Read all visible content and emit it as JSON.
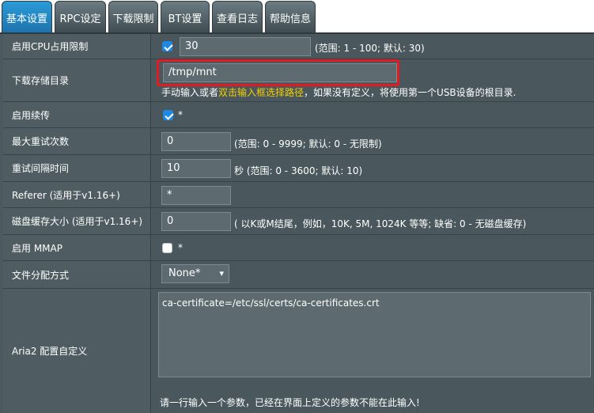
{
  "tabs": [
    {
      "label": "基本设置"
    },
    {
      "label": "RPC设定"
    },
    {
      "label": "下载限制"
    },
    {
      "label": "BT设置"
    },
    {
      "label": "查看日志"
    },
    {
      "label": "帮助信息"
    }
  ],
  "cpu": {
    "label": "启用CPU占用限制",
    "value": "30",
    "note": "(范围: 1 - 100; 默认: 30)"
  },
  "dir": {
    "label": "下载存储目录",
    "value": "/tmp/mnt",
    "hint_prefix": "手动输入或者",
    "hint_link": "双击输入框选择路径",
    "hint_suffix": "，如果没有定义，将使用第一个USB设备的根目录."
  },
  "continue": {
    "label": "启用续传",
    "star": "*"
  },
  "retries": {
    "label": "最大重试次数",
    "value": "0",
    "note": "(范围: 0 - 9999; 默认: 0 - 无限制)"
  },
  "interval": {
    "label": "重试间隔时间",
    "value": "10",
    "note": "秒 (范围: 0 - 3600; 默认: 10)"
  },
  "referer": {
    "label": "Referer (适用于v1.16+)",
    "value": "*"
  },
  "cache": {
    "label": "磁盘缓存大小 (适用于v1.16+)",
    "value": "0",
    "note": "( 以K或M结尾，例如，10K, 5M, 1024K 等等; 缺省: 0 - 无磁盘缓存)"
  },
  "mmap": {
    "label": "启用 MMAP",
    "star": "*"
  },
  "alloc": {
    "label": "文件分配方式",
    "value": "None*"
  },
  "custom": {
    "label": "Aria2 配置自定义",
    "value": "ca-certificate=/etc/ssl/certs/ca-certificates.crt",
    "hint": "请一行输入一个参数，已经在界面上定义的参数不能在此输入!"
  }
}
